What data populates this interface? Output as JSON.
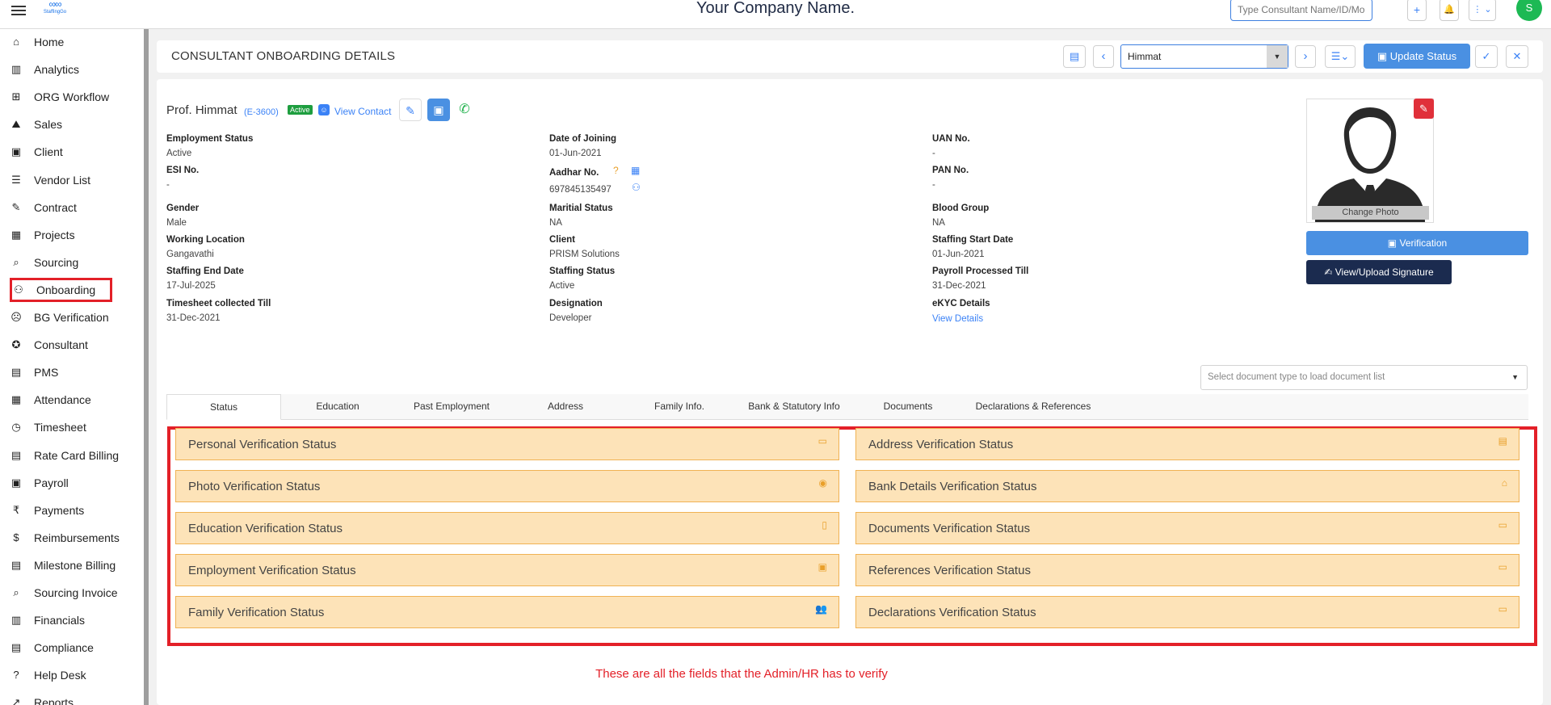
{
  "topbar": {
    "company_name": "Your Company Name.",
    "logo_text": "StaffingGo",
    "search_placeholder": "Type Consultant Name/ID/Mobile/...",
    "add_icon": "+",
    "bell_icon": "🔔",
    "more_icon": "⋮ ⌄",
    "avatar_initial": "S"
  },
  "sidebar": {
    "items": [
      {
        "label": "Home",
        "icon": "⌂"
      },
      {
        "label": "Analytics",
        "icon": "▥"
      },
      {
        "label": "ORG Workflow",
        "icon": "⊞"
      },
      {
        "label": "Sales",
        "icon": "⛰"
      },
      {
        "label": "Client",
        "icon": "▣"
      },
      {
        "label": "Vendor List",
        "icon": "☰"
      },
      {
        "label": "Contract",
        "icon": "✎"
      },
      {
        "label": "Projects",
        "icon": "▦"
      },
      {
        "label": "Sourcing",
        "icon": "⌕"
      },
      {
        "label": "Onboarding",
        "icon": "⚇"
      },
      {
        "label": "BG Verification",
        "icon": "☹"
      },
      {
        "label": "Consultant",
        "icon": "✪"
      },
      {
        "label": "PMS",
        "icon": "▤"
      },
      {
        "label": "Attendance",
        "icon": "▦"
      },
      {
        "label": "Timesheet",
        "icon": "◷"
      },
      {
        "label": "Rate Card Billing",
        "icon": "▤"
      },
      {
        "label": "Payroll",
        "icon": "▣"
      },
      {
        "label": "Payments",
        "icon": "₹"
      },
      {
        "label": "Reimbursements",
        "icon": "$"
      },
      {
        "label": "Milestone Billing",
        "icon": "▤"
      },
      {
        "label": "Sourcing Invoice",
        "icon": "⌕"
      },
      {
        "label": "Financials",
        "icon": "▥"
      },
      {
        "label": "Compliance",
        "icon": "▤"
      },
      {
        "label": "Help Desk",
        "icon": "?"
      },
      {
        "label": "Reports",
        "icon": "↗"
      }
    ]
  },
  "header": {
    "title": "CONSULTANT ONBOARDING DETAILS",
    "selected_consultant": "Himmat",
    "update_status_label": "Update Status"
  },
  "profile": {
    "name": "Prof. Himmat",
    "code": "(E-3600)",
    "status_badge": "Active",
    "view_contact": "View Contact"
  },
  "fields": {
    "employment_status": {
      "label": "Employment Status",
      "value": "Active"
    },
    "date_of_joining": {
      "label": "Date of Joining",
      "value": "01-Jun-2021"
    },
    "uan_no": {
      "label": "UAN No.",
      "value": "-"
    },
    "esi_no": {
      "label": "ESI No.",
      "value": "-"
    },
    "aadhar_no": {
      "label": "Aadhar No.",
      "value": "697845135497"
    },
    "pan_no": {
      "label": "PAN No.",
      "value": "-"
    },
    "gender": {
      "label": "Gender",
      "value": "Male"
    },
    "marital_status": {
      "label": "Maritial Status",
      "value": "NA"
    },
    "blood_group": {
      "label": "Blood Group",
      "value": "NA"
    },
    "working_location": {
      "label": "Working Location",
      "value": "Gangavathi"
    },
    "client": {
      "label": "Client",
      "value": "PRISM Solutions"
    },
    "staffing_start_date": {
      "label": "Staffing Start Date",
      "value": "01-Jun-2021"
    },
    "staffing_end_date": {
      "label": "Staffing End Date",
      "value": "17-Jul-2025"
    },
    "staffing_status": {
      "label": "Staffing Status",
      "value": "Active"
    },
    "payroll_processed_till": {
      "label": "Payroll Processed Till",
      "value": "31-Dec-2021"
    },
    "timesheet_collected_till": {
      "label": "Timesheet collected Till",
      "value": "31-Dec-2021"
    },
    "designation": {
      "label": "Designation",
      "value": "Developer"
    },
    "ekyc_details": {
      "label": "eKYC Details",
      "value": "View Details"
    }
  },
  "photo": {
    "change_photo": "Change Photo",
    "verification_label": "Verification",
    "signature_label": "View/Upload Signature"
  },
  "document_select_placeholder": "Select document type to load document list",
  "tabs": [
    "Status",
    "Education",
    "Past Employment",
    "Address",
    "Family Info.",
    "Bank & Statutory Info",
    "Documents",
    "Declarations & References"
  ],
  "verification_items": {
    "left": [
      {
        "label": "Personal Verification Status",
        "icon": "▭"
      },
      {
        "label": "Photo Verification Status",
        "icon": "◉"
      },
      {
        "label": "Education Verification Status",
        "icon": "▯"
      },
      {
        "label": "Employment Verification Status",
        "icon": "▣"
      },
      {
        "label": "Family Verification Status",
        "icon": "👥"
      }
    ],
    "right": [
      {
        "label": "Address Verification Status",
        "icon": "▤"
      },
      {
        "label": "Bank Details Verification Status",
        "icon": "⌂"
      },
      {
        "label": "Documents Verification Status",
        "icon": "▭"
      },
      {
        "label": "References Verification Status",
        "icon": "▭"
      },
      {
        "label": "Declarations Verification Status",
        "icon": "▭"
      }
    ]
  },
  "caption": "These are all the fields that the Admin/HR has to verify"
}
